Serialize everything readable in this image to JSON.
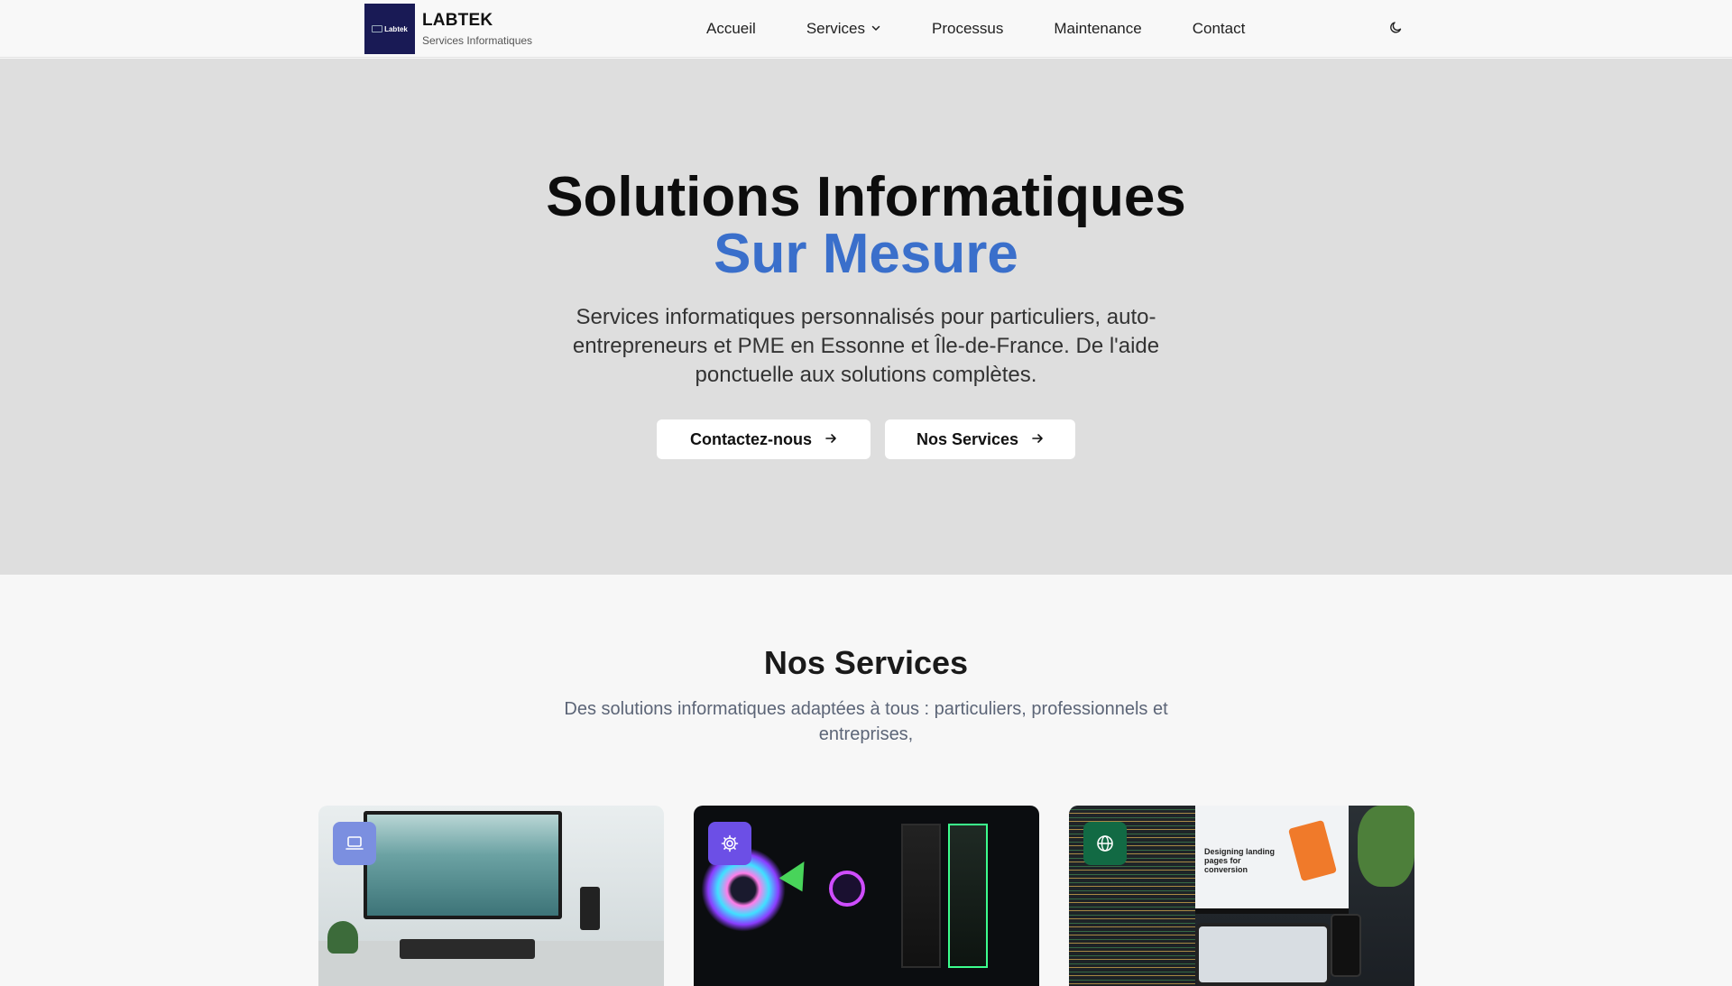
{
  "header": {
    "logo_text": "Labtek",
    "brand_name": "LABTEK",
    "brand_subtitle": "Services Informatiques",
    "nav": [
      {
        "label": "Accueil",
        "icon": ""
      },
      {
        "label": "Services",
        "icon": "chevron-down-icon"
      },
      {
        "label": "Processus",
        "icon": ""
      },
      {
        "label": "Maintenance",
        "icon": ""
      },
      {
        "label": "Contact",
        "icon": ""
      }
    ],
    "theme_toggle_icon": "moon-icon"
  },
  "hero": {
    "title_line1": "Solutions Informatiques",
    "title_line2": "Sur Mesure",
    "description": "Services informatiques personnalisés pour particuliers, auto-entrepreneurs et PME en Essonne et Île-de-France. De l'aide ponctuelle aux solutions complètes.",
    "buttons": [
      {
        "label": "Contactez-nous",
        "icon": "arrow-right-icon"
      },
      {
        "label": "Nos Services",
        "icon": "arrow-right-icon"
      }
    ]
  },
  "services": {
    "title": "Nos Services",
    "subtitle": "Des solutions informatiques adaptées à tous : particuliers, professionnels et entreprises,",
    "cards": [
      {
        "icon": "laptop-icon",
        "icon_color": "#7b8fe0",
        "image_alt": "desk setup"
      },
      {
        "icon": "gear-icon",
        "icon_color": "#6c4fe6",
        "image_alt": "gaming pc"
      },
      {
        "icon": "globe-icon",
        "icon_color": "#126a44",
        "image_alt": "web design"
      }
    ],
    "card3_image_text": "Designing landing pages for conversion"
  },
  "colors": {
    "accent": "#3a6fcb",
    "hero_bg": "#dedede",
    "page_bg": "#f7f7f7"
  }
}
